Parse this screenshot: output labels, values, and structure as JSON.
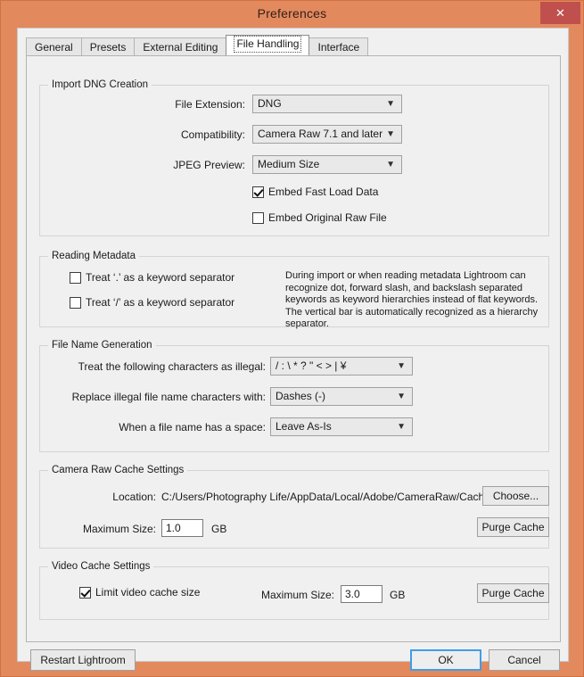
{
  "window": {
    "title": "Preferences",
    "close_label": "✕",
    "accent_color": "#e3895e",
    "close_color": "#c0504d",
    "focus_color": "#3f9ee8"
  },
  "tabs": [
    {
      "label": "General",
      "active": false
    },
    {
      "label": "Presets",
      "active": false
    },
    {
      "label": "External Editing",
      "active": false
    },
    {
      "label": "File Handling",
      "active": true
    },
    {
      "label": "Interface",
      "active": false
    }
  ],
  "import_dng": {
    "group_title": "Import DNG Creation",
    "file_extension_label": "File Extension:",
    "file_extension_value": "DNG",
    "compatibility_label": "Compatibility:",
    "compatibility_value": "Camera Raw 7.1 and later",
    "jpeg_preview_label": "JPEG Preview:",
    "jpeg_preview_value": "Medium Size",
    "embed_fast_load_label": "Embed Fast Load Data",
    "embed_fast_load_checked": true,
    "embed_original_label": "Embed Original Raw File",
    "embed_original_checked": false
  },
  "reading_metadata": {
    "group_title": "Reading Metadata",
    "dot_separator_label": "Treat ‘.’ as a keyword separator",
    "dot_separator_checked": false,
    "slash_separator_label": "Treat ‘/’ as a keyword separator",
    "slash_separator_checked": false,
    "description": "During import or when reading metadata Lightroom can recognize dot, forward slash, and backslash separated keywords as keyword hierarchies instead of flat keywords. The vertical bar is automatically recognized as a hierarchy separator."
  },
  "file_name_generation": {
    "group_title": "File Name Generation",
    "illegal_chars_label": "Treat the following characters as illegal:",
    "illegal_chars_value": "/ : \\ * ? \" < > | ¥",
    "replace_with_label": "Replace illegal file name characters with:",
    "replace_with_value": "Dashes (-)",
    "space_label": "When a file name has a space:",
    "space_value": "Leave As-Is"
  },
  "camera_raw_cache": {
    "group_title": "Camera Raw Cache Settings",
    "location_label": "Location:",
    "location_value": "C:/Users/Photography Life/AppData/Local/Adobe/CameraRaw/Cache/",
    "choose_label": "Choose...",
    "max_size_label": "Maximum Size:",
    "max_size_value": "1.0",
    "max_size_unit": "GB",
    "purge_label": "Purge Cache"
  },
  "video_cache": {
    "group_title": "Video Cache Settings",
    "limit_label": "Limit video cache size",
    "limit_checked": true,
    "max_size_label": "Maximum Size:",
    "max_size_value": "3.0",
    "max_size_unit": "GB",
    "purge_label": "Purge Cache"
  },
  "footer": {
    "restart_label": "Restart Lightroom",
    "ok_label": "OK",
    "cancel_label": "Cancel"
  }
}
